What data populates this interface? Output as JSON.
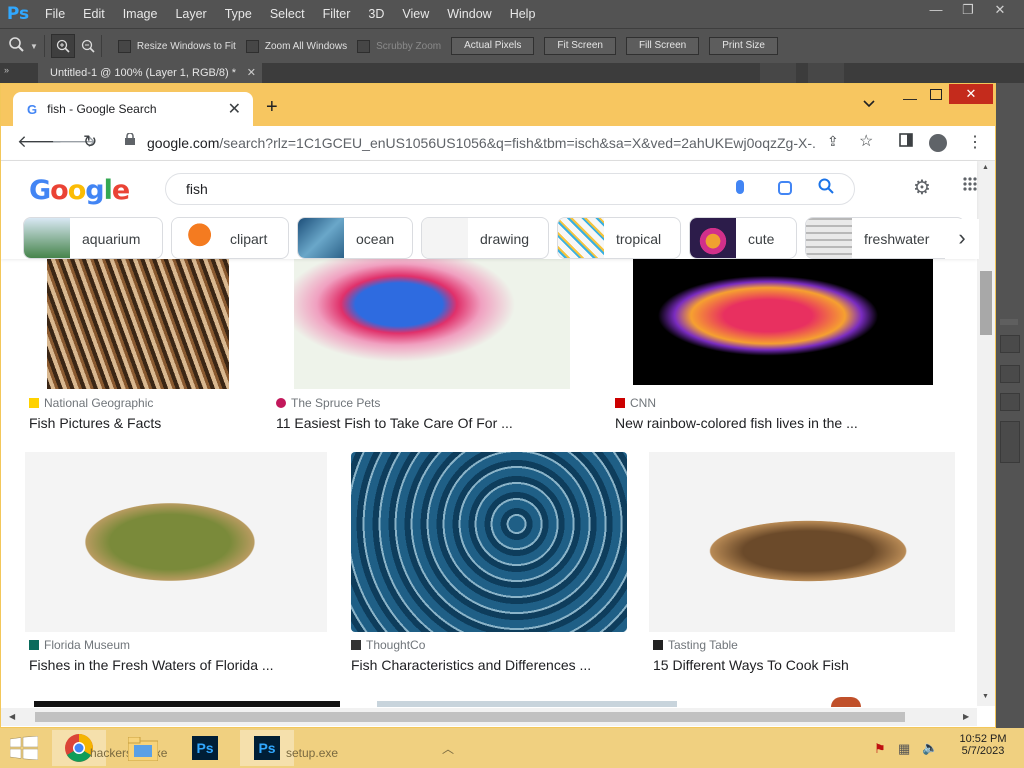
{
  "photoshop": {
    "logo": "Ps",
    "menus": [
      "File",
      "Edit",
      "Image",
      "Layer",
      "Type",
      "Select",
      "Filter",
      "3D",
      "View",
      "Window",
      "Help"
    ],
    "window_controls": [
      "—",
      "❐",
      "✕"
    ],
    "options": {
      "resize_windows": "Resize Windows to Fit",
      "zoom_all": "Zoom All Windows",
      "scrubby_zoom": "Scrubby Zoom",
      "actual_pixels": "Actual Pixels",
      "fit_screen": "Fit Screen",
      "fill_screen": "Fill Screen",
      "print_size": "Print Size"
    },
    "document_tab": "Untitled-1 @ 100% (Layer 1, RGB/8) *",
    "document_tab_close": "✕"
  },
  "chrome": {
    "tab_title": "fish - Google Search",
    "tab_favicon": "G",
    "tab_close": "✕",
    "new_tab": "+",
    "url_host": "google.com",
    "url_path": "/search?rlz=1C1GCEU_enUS1056US1056&q=fish&tbm=isch&sa=X&ved=2ahUKEwj0oqzZg-X-..."
  },
  "google": {
    "logo_letters": [
      "G",
      "o",
      "o",
      "g",
      "l",
      "e"
    ],
    "logo_colors": [
      "#4285f4",
      "#ea4335",
      "#fbbc05",
      "#4285f4",
      "#34a853",
      "#ea4335"
    ],
    "search_query": "fish",
    "chips": [
      {
        "label": "aquarium"
      },
      {
        "label": "clipart"
      },
      {
        "label": "ocean"
      },
      {
        "label": "drawing"
      },
      {
        "label": "tropical"
      },
      {
        "label": "cute"
      },
      {
        "label": "freshwater"
      }
    ],
    "results": [
      {
        "source": "National Geographic",
        "title": "Fish Pictures & Facts"
      },
      {
        "source": "The Spruce Pets",
        "title": "11 Easiest Fish to Take Care Of For ..."
      },
      {
        "source": "CNN",
        "title": "New rainbow-colored fish lives in the ..."
      },
      {
        "source": "Florida Museum",
        "title": "Fishes in the Fresh Waters of Florida ..."
      },
      {
        "source": "ThoughtCo",
        "title": "Fish Characteristics and Differences ..."
      },
      {
        "source": "Tasting Table",
        "title": "15 Different Ways To Cook Fish"
      }
    ]
  },
  "taskbar": {
    "items": [
      "hackerss...exe",
      "setup.exe"
    ],
    "time": "10:52 PM",
    "date": "5/7/2023"
  }
}
